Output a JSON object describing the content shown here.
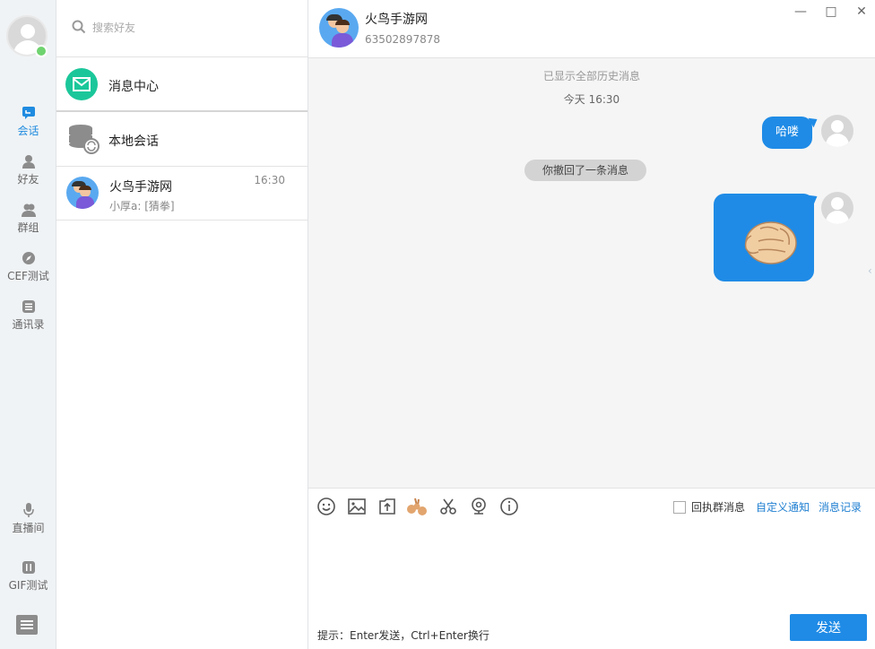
{
  "nav": {
    "items": [
      {
        "label": "会话",
        "icon": "chat-icon"
      },
      {
        "label": "好友",
        "icon": "friend-icon"
      },
      {
        "label": "群组",
        "icon": "group-icon"
      },
      {
        "label": "CEF测试",
        "icon": "compass-icon"
      },
      {
        "label": "通讯录",
        "icon": "contacts-icon"
      },
      {
        "label": "直播间",
        "icon": "microphone-icon"
      },
      {
        "label": "GIF测试",
        "icon": "gif-icon"
      }
    ],
    "accent": "#1f8be0",
    "online_color": "#6fd36f"
  },
  "search": {
    "placeholder": "搜索好友"
  },
  "list": {
    "message_center": "消息中心",
    "local_session": "本地会话",
    "conversations": [
      {
        "name": "火鸟手游网",
        "time": "16:30",
        "preview": "小厚a: [猜拳]"
      }
    ]
  },
  "chat": {
    "title": "火鸟手游网",
    "id": "63502897878",
    "history_notice": "已显示全部历史消息",
    "timestamp": "今天 16:30",
    "messages": [
      {
        "type": "text",
        "text": "哈喽",
        "from": "me"
      },
      {
        "type": "system",
        "text": "你撤回了一条消息"
      },
      {
        "type": "image",
        "content": "fist-emoji",
        "from": "me"
      }
    ],
    "bubble_color": "#1f8be6"
  },
  "toolbar": {
    "receipt_label": "回执群消息",
    "custom_notify": "自定义通知",
    "history": "消息记录"
  },
  "input": {
    "hint": "提示：Enter发送，Ctrl+Enter换行",
    "send_label": "发送"
  }
}
